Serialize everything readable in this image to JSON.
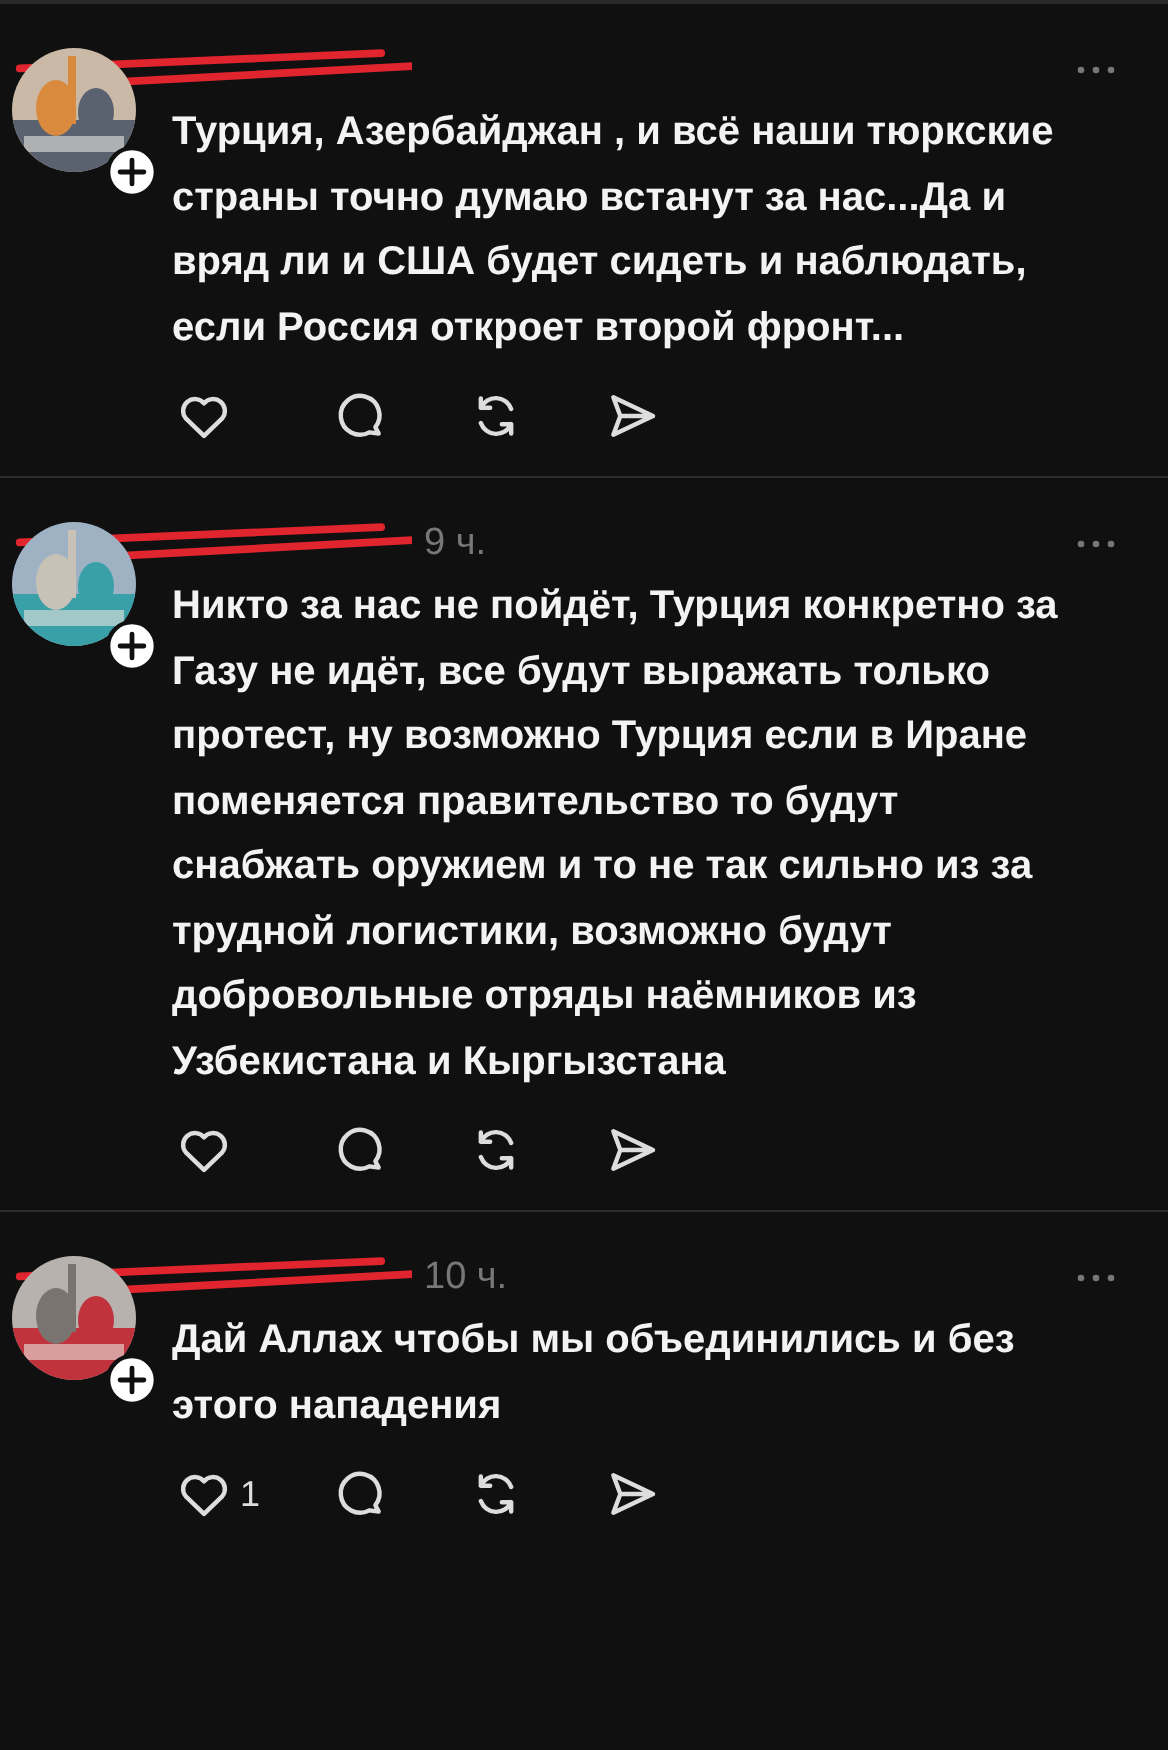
{
  "posts": [
    {
      "text": "Турция, Азербайджан , и всё наши тюркские страны точно думаю встанут за нас...Да и вряд ли и США будет сидеть и наблюдать, если Россия откроет второй фронт..."
    },
    {
      "time": "9 ч.",
      "text": "Никто за нас не пойдёт, Турция конкретно за Газу не идёт, все будут выражать только протест, ну возможно Турция если в Иране поменяется правительство то будут снабжать оружием и то не так сильно из за трудной логистики, возможно будут добровольные отряды наёмников из Узбекистана и Кыргызстана"
    },
    {
      "time": "10 ч.",
      "text": "Дай Аллах чтобы мы объединились и без этого нападения",
      "likes": "1"
    }
  ]
}
